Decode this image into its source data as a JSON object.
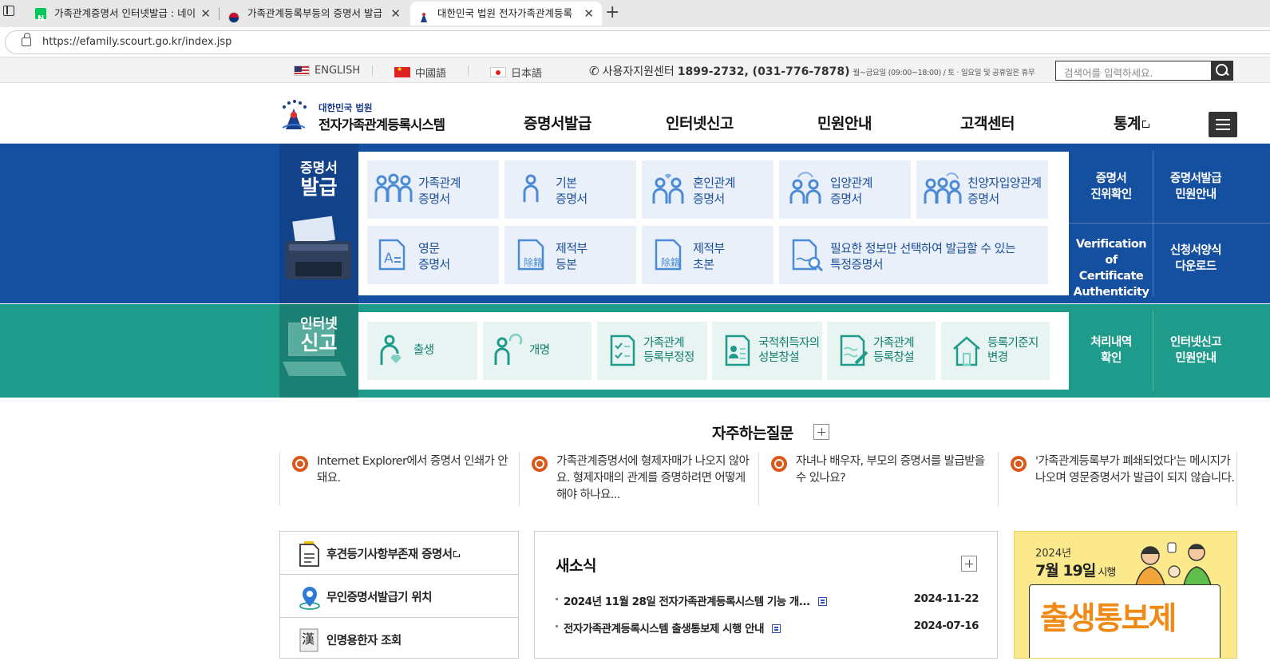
{
  "browser": {
    "tabs": [
      {
        "title": "가족관계증명서 인터넷발급 : 네이",
        "favicon": "naver-icon"
      },
      {
        "title": "가족관계등록부등의 증명서 발급",
        "favicon": "korea-gov-icon"
      },
      {
        "title": "대한민국 법원 전자가족관계등록",
        "favicon": "court-icon",
        "active": true
      }
    ],
    "url": "https://efamily.scourt.go.kr/index.jsp"
  },
  "util": {
    "languages": [
      {
        "label": "ENGLISH",
        "flag": "us-flag-icon"
      },
      {
        "label": "中國語",
        "flag": "china-flag-icon"
      },
      {
        "label": "日本語",
        "flag": "japan-flag-icon"
      }
    ],
    "support_label": "사용자지원센터",
    "support_phone": "1899-2732, (031-776-7878)",
    "support_hours": "월~금요일 (09:00~18:00) / 토 · 일요일 및 공휴일은 휴무",
    "search_placeholder": "검색어를 입력하세요."
  },
  "header": {
    "logo_line1": "대한민국 법원",
    "logo_line2": "전자가족관계등록시스템",
    "nav": [
      "증명서발급",
      "인터넷신고",
      "민원안내",
      "고객센터",
      "통계"
    ]
  },
  "cert": {
    "title_small": "증명서",
    "title_big": "발급",
    "cards": [
      {
        "label": "가족관계\n증명서",
        "icon": "family-icon"
      },
      {
        "label": "기본\n증명서",
        "icon": "person-icon"
      },
      {
        "label": "혼인관계\n증명서",
        "icon": "marriage-icon"
      },
      {
        "label": "입양관계\n증명서",
        "icon": "adoption-icon"
      },
      {
        "label": "친양자입양관계\n증명서",
        "icon": "full-adoption-icon"
      },
      {
        "label": "영문\n증명서",
        "icon": "english-doc-icon"
      },
      {
        "label": "제적부\n등본",
        "icon": "removed-register-icon"
      },
      {
        "label": "제적부\n초본",
        "icon": "removed-register-icon"
      },
      {
        "label": "필요한 정보만 선택하여 발급할 수 있는\n특정증명서",
        "icon": "doc-search-icon"
      }
    ],
    "side": [
      "증명서\n진위확인",
      "증명서발급\n민원안내",
      "Verification of\nCertificate\nAuthenticity",
      "신청서양식\n다운로드"
    ]
  },
  "report": {
    "title_small": "인터넷",
    "title_big": "신고",
    "cards": [
      {
        "label": "출생",
        "icon": "birth-icon"
      },
      {
        "label": "개명",
        "icon": "name-change-icon"
      },
      {
        "label": "가족관계\n등록부정정",
        "icon": "checklist-icon"
      },
      {
        "label": "국적취득자의\n성본창설",
        "icon": "id-card-icon"
      },
      {
        "label": "가족관계\n등록창설",
        "icon": "doc-pen-icon"
      },
      {
        "label": "등록기준지\n변경",
        "icon": "house-icon"
      }
    ],
    "side": [
      "처리내역\n확인",
      "인터넷신고\n민원안내"
    ]
  },
  "faq": {
    "title": "자주하는질문",
    "items": [
      "Internet Explorer에서 증명서 인쇄가 안돼요.",
      "가족관계증명서에 형제자매가 나오지 않아요. 형제자매의 관계를 증명하려면 어떻게 해야 하나요...",
      "자녀나 배우자, 부모의 증명서를 발급받을 수 있나요?",
      "'가족관계등록부가 폐쇄되었다'는 메시지가 나오며 영문증명서가 발급이 되지 않습니다."
    ]
  },
  "quick": [
    {
      "label": "후견등기사항부존재 증명서",
      "icon": "document-icon",
      "external": true
    },
    {
      "label": "무인증명서발급기 위치",
      "icon": "location-pin-icon"
    },
    {
      "label": "인명용한자 조회",
      "icon": "hanja-book-icon"
    }
  ],
  "news": {
    "title": "새소식",
    "items": [
      {
        "title": "2024년 11월 28일 전자가족관계등록시스템 기능 개...",
        "date": "2024-11-22"
      },
      {
        "title": "전자가족관계등록시스템 출생통보제 시행 안내",
        "date": "2024-07-16"
      }
    ]
  },
  "banner": {
    "year": "2024년",
    "date_main": "7월 19일",
    "date_suffix": " 시행",
    "title": "출생통보제"
  }
}
